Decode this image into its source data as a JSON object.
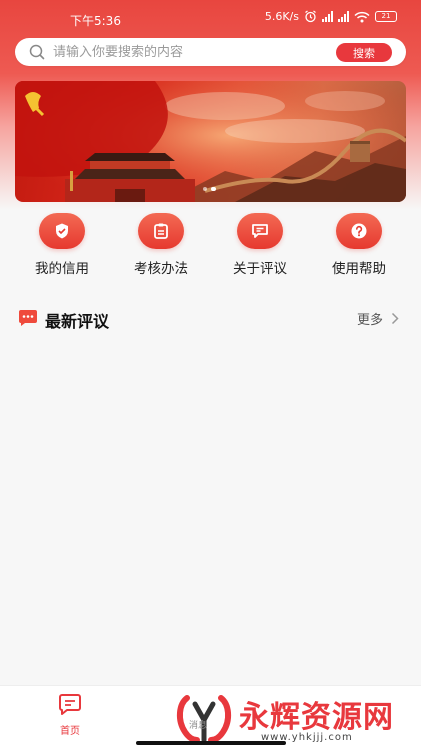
{
  "status_bar": {
    "time": "下午5:36",
    "network_speed": "5.6K/s",
    "battery": "21"
  },
  "search": {
    "placeholder": "请输入你要搜索的内容",
    "button_label": "搜索"
  },
  "banner": {
    "slides": 2,
    "active_index": 1
  },
  "quick_menu": {
    "items": [
      {
        "label": "我的信用",
        "icon": "shield-check-icon"
      },
      {
        "label": "考核办法",
        "icon": "clipboard-icon"
      },
      {
        "label": "关于评议",
        "icon": "message-icon"
      },
      {
        "label": "使用帮助",
        "icon": "question-icon"
      }
    ]
  },
  "section": {
    "title": "最新评议",
    "more_label": "更多"
  },
  "tab_bar": {
    "tabs": [
      {
        "label": "首页",
        "icon": "home-chat-icon",
        "active": true
      }
    ]
  },
  "watermark": {
    "text": "永辉资源网",
    "url": "www.yhkjjj.com",
    "small": "消息"
  },
  "colors": {
    "accent": "#e8383d",
    "background": "#f7f7f7"
  }
}
